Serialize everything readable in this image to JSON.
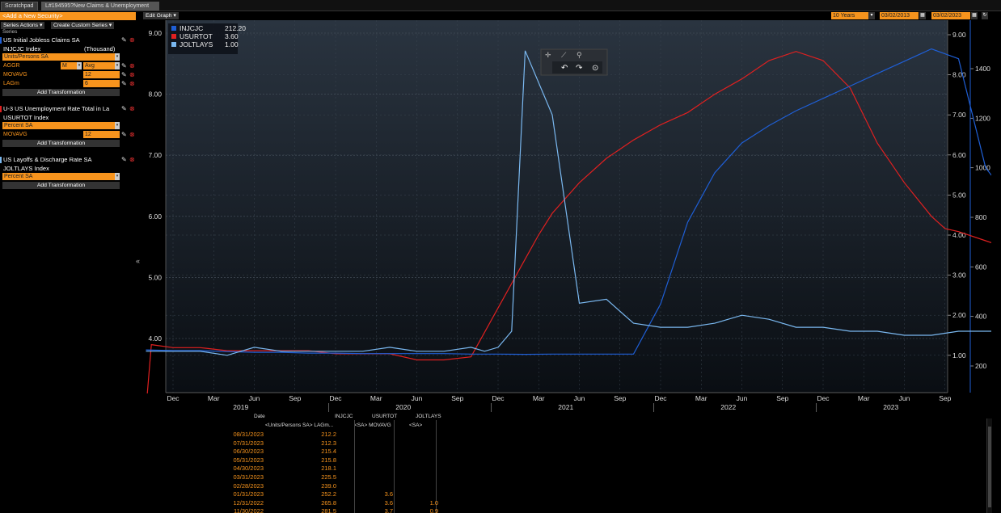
{
  "tabs": [
    "Scratchpad",
    "L#194595?New Claims & Unemployment"
  ],
  "left": {
    "add_security": "<Add a New Security>",
    "series_actions": "Series Actions",
    "create_custom": "Create Custom Series",
    "series_label": "Series",
    "add_transformation": "Add Transformation",
    "s1": {
      "title": "US Initial Jobless Claims SA",
      "ticker": "INJCJC Index",
      "unit_note": "(Thousand)",
      "units": "Units/Persons SA",
      "aggr_label": "AGGR",
      "aggr_freq": "M",
      "aggr_method": "Avg",
      "movavg_label": "MOVAVG",
      "movavg_val": "12",
      "lag_label": "LAGm",
      "lag_val": "6",
      "color": "#1f5fd6"
    },
    "s2": {
      "title": "U-3 US Unemployment Rate Total in La",
      "ticker": "USURTOT Index",
      "units": "Percent SA",
      "movavg_label": "MOVAVG",
      "movavg_val": "12",
      "color": "#e02020"
    },
    "s3": {
      "title": "US Layoffs & Discharge Rate SA",
      "ticker": "JOLTLAYS Index",
      "units": "Percent SA",
      "color": "#7ab8f0"
    }
  },
  "header": {
    "edit_graph": "Edit Graph",
    "range": "10 Years",
    "start_date": "03/02/2013",
    "end_date": "03/02/2023"
  },
  "table": {
    "headers": [
      "Date",
      "INJCJC",
      "USURTOT",
      "JOLTLAYS"
    ],
    "subheaders": [
      "<Units/Persons SA> LAGm...",
      "<SA> MOVAVG",
      "<SA>"
    ],
    "rows": [
      [
        "08/31/2023",
        "212.2",
        "",
        ""
      ],
      [
        "07/31/2023",
        "212.3",
        "",
        ""
      ],
      [
        "06/30/2023",
        "215.4",
        "",
        ""
      ],
      [
        "05/31/2023",
        "215.8",
        "",
        ""
      ],
      [
        "04/30/2023",
        "218.1",
        "",
        ""
      ],
      [
        "03/31/2023",
        "225.5",
        "",
        ""
      ],
      [
        "02/28/2023",
        "239.0",
        "",
        ""
      ],
      [
        "01/31/2023",
        "252.2",
        "3.6",
        ""
      ],
      [
        "12/31/2022",
        "265.8",
        "3.6",
        "1.0"
      ],
      [
        "11/30/2022",
        "281.5",
        "3.7",
        "0.9"
      ]
    ]
  },
  "chart_data": {
    "type": "line",
    "legend": [
      {
        "name": "INJCJC",
        "value": "212.20",
        "color": "#1f5fd6"
      },
      {
        "name": "USURTOT",
        "value": "3.60",
        "color": "#e02020"
      },
      {
        "name": "JOLTLAYS",
        "value": "1.00",
        "color": "#7ab8f0"
      }
    ],
    "legend_position": "top-left",
    "month_ticks": [
      "Dec",
      "Mar",
      "Jun",
      "Sep",
      "Dec",
      "Mar",
      "Jun",
      "Sep",
      "Dec",
      "Mar",
      "Jun",
      "Sep",
      "Dec",
      "Mar",
      "Jun",
      "Sep",
      "Dec",
      "Mar",
      "Jun",
      "Sep"
    ],
    "years": [
      "2019",
      "2020",
      "2021",
      "2022",
      "2023"
    ],
    "left_axis": {
      "ticks": [
        "4.00",
        "5.00",
        "6.00",
        "7.00",
        "8.00",
        "9.00"
      ],
      "min": 3.1,
      "max": 9.2
    },
    "right_axis_inner": {
      "ticks": [
        "1.00",
        "2.00",
        "3.00",
        "4.00",
        "5.00",
        "6.00",
        "7.00",
        "8.00",
        "9.00"
      ],
      "min": 0.1,
      "max": 9.1
    },
    "right_axis_outer": {
      "ticks": [
        "200",
        "400",
        "600",
        "800",
        "1000",
        "1200",
        "1400"
      ],
      "min": 0,
      "max": 1600
    },
    "grid": true,
    "series": [
      {
        "name": "USURTOT",
        "axis": "left",
        "color": "#e02020",
        "x_month": [
          -1.9,
          -1.6,
          0,
          2,
          4,
          6,
          8,
          10,
          12,
          14,
          16,
          18,
          20,
          22,
          24,
          26,
          27,
          28,
          30,
          32,
          34,
          36,
          38,
          40,
          42,
          44,
          46,
          48,
          50,
          52,
          54,
          56,
          57,
          58,
          60,
          62,
          64,
          66,
          68,
          70,
          72,
          74,
          76,
          78,
          80,
          82,
          84,
          86
        ],
        "y": [
          3.1,
          3.9,
          3.85,
          3.85,
          3.8,
          3.8,
          3.8,
          3.8,
          3.75,
          3.75,
          3.75,
          3.65,
          3.65,
          3.7,
          4.5,
          5.3,
          5.7,
          6.05,
          6.55,
          6.95,
          7.25,
          7.5,
          7.7,
          8.0,
          8.25,
          8.55,
          8.7,
          8.55,
          8.1,
          7.2,
          6.55,
          6.0,
          5.8,
          5.75,
          5.6,
          5.45,
          5.3,
          5.15,
          5.0,
          4.85,
          4.7,
          4.55,
          4.35,
          4.15,
          4.0,
          3.85,
          3.7,
          3.6
        ]
      },
      {
        "name": "INJCJC",
        "axis": "right_outer",
        "color": "#1f5fd6",
        "x_month": [
          -2,
          0,
          2,
          4,
          6,
          8,
          10,
          12,
          14,
          16,
          18,
          20,
          22,
          24,
          26,
          28,
          30,
          32,
          34,
          36,
          38,
          40,
          42,
          44,
          46,
          48,
          50,
          52,
          54,
          56,
          58,
          60,
          62,
          64,
          66,
          68,
          70,
          72,
          74,
          76,
          78,
          80,
          82,
          84,
          86,
          88,
          90,
          92,
          94,
          96,
          98,
          100,
          102
        ],
        "y": [
          265,
          262,
          262,
          258,
          255,
          255,
          252,
          252,
          250,
          250,
          250,
          250,
          248,
          248,
          247,
          248,
          248,
          248,
          248,
          450,
          780,
          980,
          1100,
          1170,
          1230,
          1280,
          1330,
          1380,
          1430,
          1480,
          1440,
          1000,
          860,
          760,
          700,
          660,
          630,
          600,
          565,
          525,
          480,
          435,
          395,
          360,
          330,
          305,
          285,
          270,
          260,
          252,
          248,
          244,
          244
        ]
      },
      {
        "name": "JOLTLAYS",
        "axis": "right_inner",
        "color": "#7ab8f0",
        "x_month": [
          -2,
          0,
          2,
          4,
          6,
          8,
          10,
          12,
          14,
          16,
          18,
          20,
          22,
          23,
          24,
          25,
          26,
          28,
          30,
          32,
          34,
          36,
          38,
          40,
          42,
          44,
          46,
          48,
          50,
          52,
          54,
          56,
          58,
          60,
          62,
          64,
          66,
          68,
          70,
          72,
          74,
          76,
          78,
          80,
          82,
          84,
          86,
          88
        ],
        "y": [
          1.1,
          1.1,
          1.1,
          1.0,
          1.2,
          1.1,
          1.1,
          1.1,
          1.1,
          1.2,
          1.1,
          1.1,
          1.2,
          1.1,
          1.2,
          1.6,
          8.6,
          7.0,
          2.3,
          2.4,
          1.8,
          1.7,
          1.7,
          1.8,
          2.0,
          1.9,
          1.7,
          1.7,
          1.6,
          1.6,
          1.5,
          1.5,
          1.6,
          1.6,
          1.6,
          1.5,
          1.5,
          1.4,
          1.5,
          1.5,
          1.5,
          1.5,
          1.5,
          1.5,
          1.6,
          1.5,
          1.5,
          1.6
        ]
      }
    ]
  }
}
